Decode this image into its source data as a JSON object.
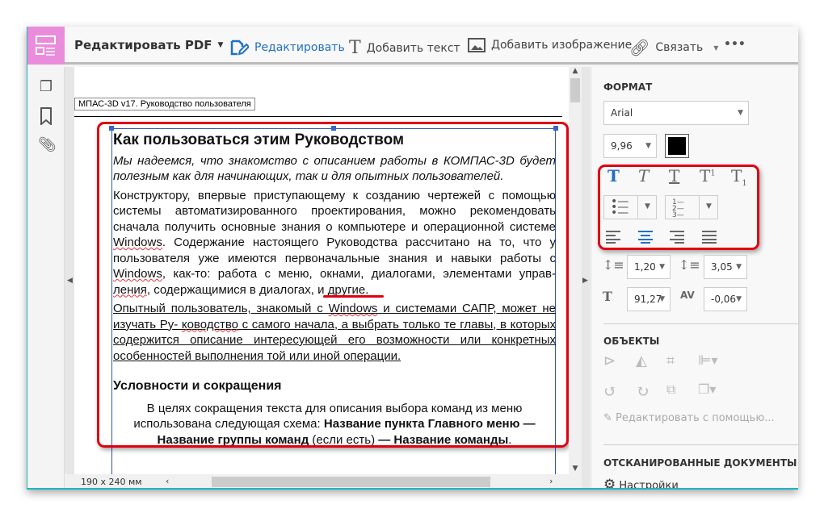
{
  "toolbar": {
    "title": "Редактировать PDF",
    "edit": "Редактировать",
    "add_text": "Добавить текст",
    "add_image": "Добавить изображение",
    "link": "Связать",
    "more": "•••"
  },
  "document": {
    "header": "МПАС-3D v17. Руководство пользователя",
    "h1": "Как пользоваться этим Руководством",
    "intro": "Мы надеемся, что знакомство с описанием работы в КОМПАС-3D будет полезным как для начинающих, так и для опытных пользователей.",
    "p1": [
      "Конструктору, впервые приступающему к созданию чертежей с помощью системы автоматизированного проектирования, можно рекомендовать сначала получить основные знания о компьютере и операционной системе ",
      "Windows",
      ". Содержание настоящего Руководства рассчитано на то, что у пользователя уже имеются первоначальные знания и навыки работы с ",
      "Windows",
      ", как-то: работа с меню, окнами, диалогами, элементами управ-",
      "ления",
      ", содержащимися в диалогах, и другие."
    ],
    "p2": [
      "Опытный пользователь, знакомый с ",
      "Windows",
      " и системами САПР, может не изучать Ру- ",
      "ководство",
      " с самого начала, а выбрать только те главы, в которых содержится описание интересующей его возможности или конкретных особенностей выполнения той или иной операции."
    ],
    "h2": "Условности и сокращения",
    "p3": [
      "В целях сокращения текста для описания выбора команд из меню использована следующая схема: ",
      "Название пункта Главного меню — Название группы команд",
      " (если есть) ",
      "— Название команды",
      "."
    ]
  },
  "status": {
    "page_size": "190 x 240 мм"
  },
  "format": {
    "heading": "ФОРМАТ",
    "font": "Arial",
    "size": "9,96",
    "color": "#000000",
    "line_spacing": "1,20",
    "para_spacing": "3,05",
    "scale": "91,27",
    "tracking": "-0,06",
    "active_align": "center"
  },
  "objects": {
    "heading": "ОБЪЕКТЫ",
    "edit_with": "Редактировать с помощью..."
  },
  "scanned": {
    "heading": "ОТСКАНИРОВАННЫЕ ДОКУМЕНТЫ",
    "settings": "Настройки"
  },
  "colors": {
    "accent": "#1f6fc5",
    "logo": "#ea8cdc",
    "highlight": "#e00010"
  }
}
